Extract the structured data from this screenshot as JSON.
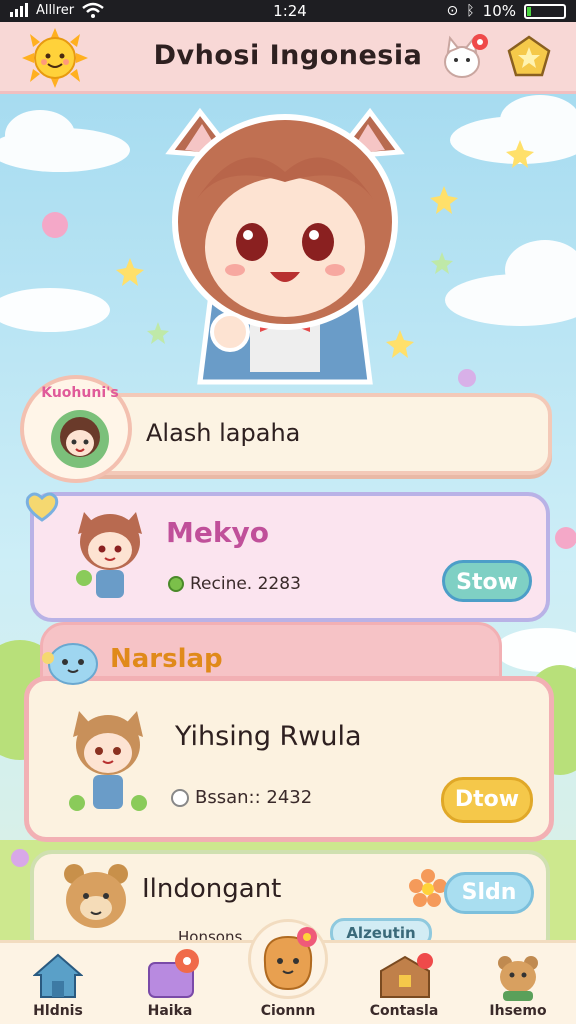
{
  "status_bar": {
    "carrier": "Alllrer",
    "time": "1:24",
    "battery": "10%",
    "battery_level": 0.1
  },
  "header": {
    "title": "Dvhosi Ingonesia"
  },
  "profile_card": {
    "badge": "Kuohuni's",
    "name": "Alash lapaha"
  },
  "entries": [
    {
      "name": "Mekyo",
      "detail": "Recine. 2283",
      "button": "Stow"
    },
    {
      "name": "Yihsing Rwula",
      "detail": "Bssan:: 2432",
      "button": "Dtow"
    },
    {
      "name": "Ilndongant",
      "detail": "Honsons",
      "button": "Sldn",
      "extra": "Alzeutin"
    }
  ],
  "section": {
    "title": "Narslap"
  },
  "bottom_nav": [
    {
      "label": "Hldnis",
      "icon": "house-icon"
    },
    {
      "label": "Haika",
      "icon": "gift-box-icon"
    },
    {
      "label": "Cionnn",
      "icon": "character-icon"
    },
    {
      "label": "Contasla",
      "icon": "chest-icon"
    },
    {
      "label": "Ihsemo",
      "icon": "bear-icon"
    }
  ],
  "colors": {
    "header_bg": "#f8d8d6",
    "stow_button": "#7fd0c4",
    "dtow_button": "#f5c84a",
    "sldn_button": "#a9def0",
    "mekyo_name": "#c0509a",
    "narslap_title": "#e08a1a"
  }
}
